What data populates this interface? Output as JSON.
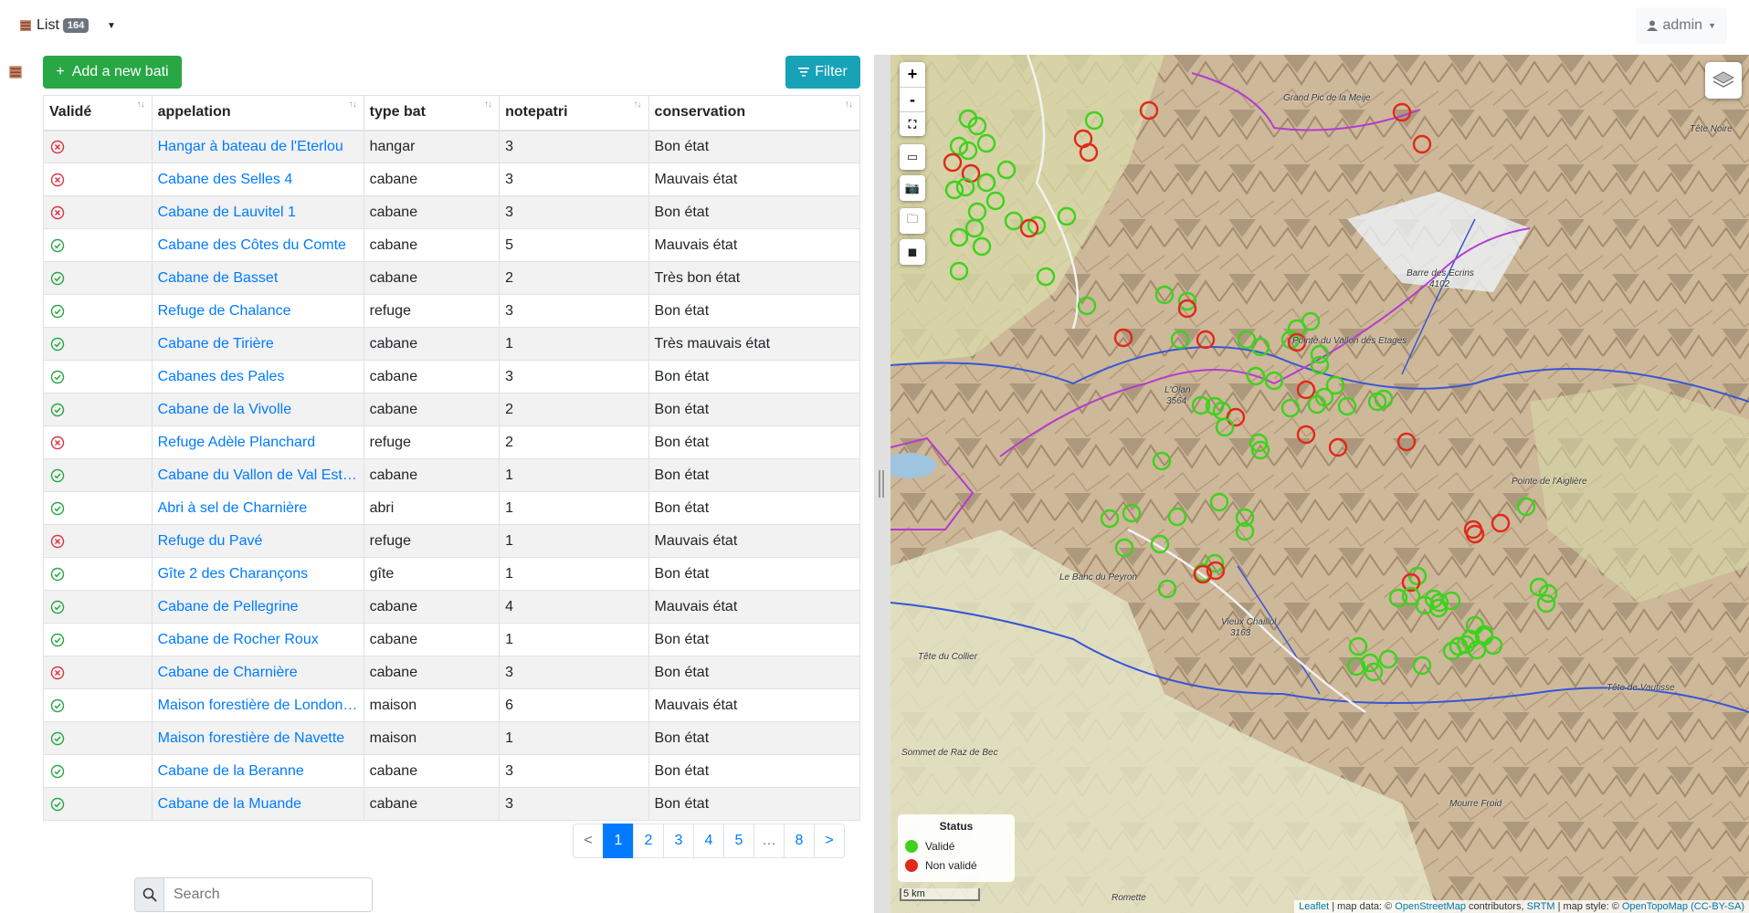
{
  "header": {
    "list_label": "List",
    "list_count": "164",
    "user_label": "admin"
  },
  "toolbar": {
    "add_label": "Add a new bati",
    "filter_label": "Filter"
  },
  "table": {
    "columns": [
      "Validé",
      "appelation",
      "type bat",
      "notepatri",
      "conservation"
    ],
    "rows": [
      {
        "valid": false,
        "name": "Hangar à bateau de l'Eterlou",
        "type": "hangar",
        "note": "3",
        "conservation": "Bon état"
      },
      {
        "valid": false,
        "name": "Cabane des Selles 4",
        "type": "cabane",
        "note": "3",
        "conservation": "Mauvais état"
      },
      {
        "valid": false,
        "name": "Cabane de Lauvitel 1",
        "type": "cabane",
        "note": "3",
        "conservation": "Bon état"
      },
      {
        "valid": true,
        "name": "Cabane des Côtes du Comte",
        "type": "cabane",
        "note": "5",
        "conservation": "Mauvais état"
      },
      {
        "valid": true,
        "name": "Cabane de Basset",
        "type": "cabane",
        "note": "2",
        "conservation": "Très bon état"
      },
      {
        "valid": true,
        "name": "Refuge de Chalance",
        "type": "refuge",
        "note": "3",
        "conservation": "Bon état"
      },
      {
        "valid": true,
        "name": "Cabane de Tirière",
        "type": "cabane",
        "note": "1",
        "conservation": "Très mauvais état"
      },
      {
        "valid": true,
        "name": "Cabanes des Pales",
        "type": "cabane",
        "note": "3",
        "conservation": "Bon état"
      },
      {
        "valid": true,
        "name": "Cabane de la Vivolle",
        "type": "cabane",
        "note": "2",
        "conservation": "Bon état"
      },
      {
        "valid": false,
        "name": "Refuge Adèle Planchard",
        "type": "refuge",
        "note": "2",
        "conservation": "Bon état"
      },
      {
        "valid": true,
        "name": "Cabane du Vallon de Val Estrèche",
        "type": "cabane",
        "note": "1",
        "conservation": "Bon état"
      },
      {
        "valid": true,
        "name": "Abri à sel de Charnière",
        "type": "abri",
        "note": "1",
        "conservation": "Bon état"
      },
      {
        "valid": false,
        "name": "Refuge du Pavé",
        "type": "refuge",
        "note": "1",
        "conservation": "Mauvais état"
      },
      {
        "valid": true,
        "name": "Gîte 2 des Charançons",
        "type": "gîte",
        "note": "1",
        "conservation": "Bon état"
      },
      {
        "valid": true,
        "name": "Cabane de Pellegrine",
        "type": "cabane",
        "note": "4",
        "conservation": "Mauvais état"
      },
      {
        "valid": true,
        "name": "Cabane de Rocher Roux",
        "type": "cabane",
        "note": "1",
        "conservation": "Bon état"
      },
      {
        "valid": false,
        "name": "Cabane de Charnière",
        "type": "cabane",
        "note": "3",
        "conservation": "Bon état"
      },
      {
        "valid": true,
        "name": "Maison forestière de Londonière",
        "type": "maison",
        "note": "6",
        "conservation": "Mauvais état"
      },
      {
        "valid": true,
        "name": "Maison forestière de Navette",
        "type": "maison",
        "note": "1",
        "conservation": "Bon état"
      },
      {
        "valid": true,
        "name": "Cabane de la Beranne",
        "type": "cabane",
        "note": "3",
        "conservation": "Bon état"
      },
      {
        "valid": true,
        "name": "Cabane de la Muande",
        "type": "cabane",
        "note": "3",
        "conservation": "Bon état"
      }
    ]
  },
  "pagination": {
    "prev": "<",
    "pages": [
      "1",
      "2",
      "3",
      "4",
      "5"
    ],
    "ellipsis": "…",
    "last": "8",
    "next": ">",
    "active": "1"
  },
  "search": {
    "placeholder": "Search"
  },
  "map": {
    "zoom_in": "+",
    "zoom_out": "-",
    "legend_title": "Status",
    "legend_valid": "Validé",
    "legend_invalid": "Non validé",
    "scale": "5 km",
    "attribution": {
      "leaflet": "Leaflet",
      "data_prefix": " | map data: © ",
      "osm": "OpenStreetMap",
      "contrib": " contributors, ",
      "srtm": "SRTM",
      "style": " | map style: © ",
      "otm": "OpenTopoMap",
      "license": "(CC-BY-SA)"
    },
    "peaks": [
      "Grand Pic de la Meije",
      "Tête Noire",
      "Barre des Ecrins",
      "4102",
      "Pointe du Vallon des Etages",
      "L'Olan",
      "3564",
      "Pointe de l'Aiglière",
      "Le Banc du Peyron",
      "Vieux Chaillol",
      "3163",
      "Tête du Collier",
      "Tête de Vautisse",
      "Sommet de Raz de Bec",
      "Mourre Froid",
      "Romette"
    ],
    "colors": {
      "valid": "#3fd11f",
      "invalid": "#e0291c"
    }
  }
}
